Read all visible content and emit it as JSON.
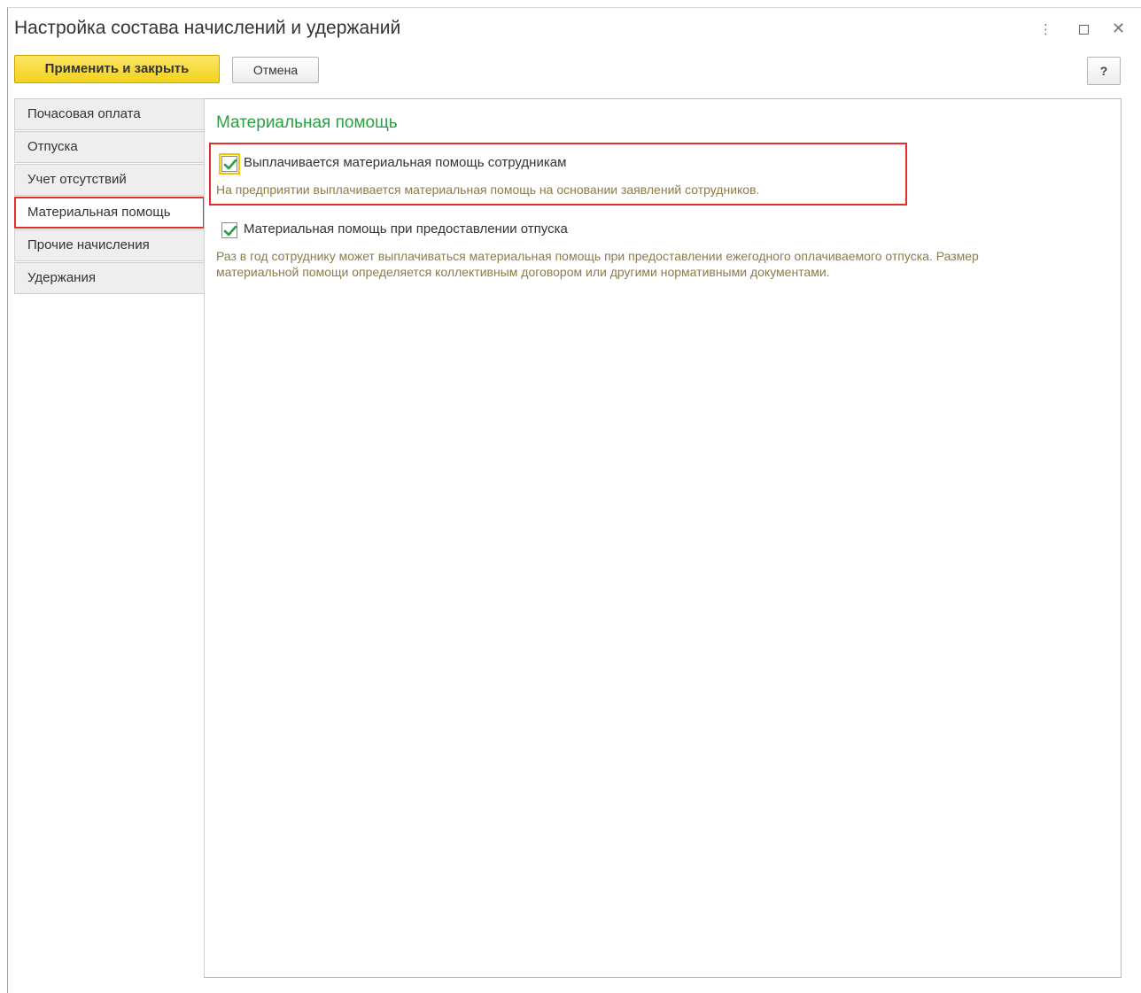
{
  "window": {
    "title": "Настройка состава начислений и удержаний",
    "controls": {
      "more": "⋮",
      "close": "✕"
    }
  },
  "toolbar": {
    "apply_label": "Применить и закрыть",
    "cancel_label": "Отмена",
    "help_label": "?"
  },
  "tabs": [
    {
      "label": "Почасовая оплата",
      "active": false
    },
    {
      "label": "Отпуска",
      "active": false
    },
    {
      "label": "Учет отсутствий",
      "active": false
    },
    {
      "label": "Материальная помощь",
      "active": true
    },
    {
      "label": "Прочие начисления",
      "active": false
    },
    {
      "label": "Удержания",
      "active": false
    }
  ],
  "section": {
    "title": "Материальная помощь",
    "options": [
      {
        "label": "Выплачивается материальная помощь сотрудникам",
        "checked": true,
        "hint": "На предприятии выплачивается материальная помощь на основании заявлений сотрудников."
      },
      {
        "label": "Материальная помощь при предоставлении отпуска",
        "checked": true,
        "hint": "Раз в год сотруднику может выплачиваться материальная помощь при предоставлении ежегодного оплачиваемого отпуска. Размер материальной помощи определяется коллективным договором или другими нормативными документами."
      }
    ]
  },
  "colors": {
    "accent_green": "#2aa043",
    "highlight_red": "#e32e2e",
    "primary_button": "#f3d21d",
    "hint_text": "#8b7c48"
  }
}
